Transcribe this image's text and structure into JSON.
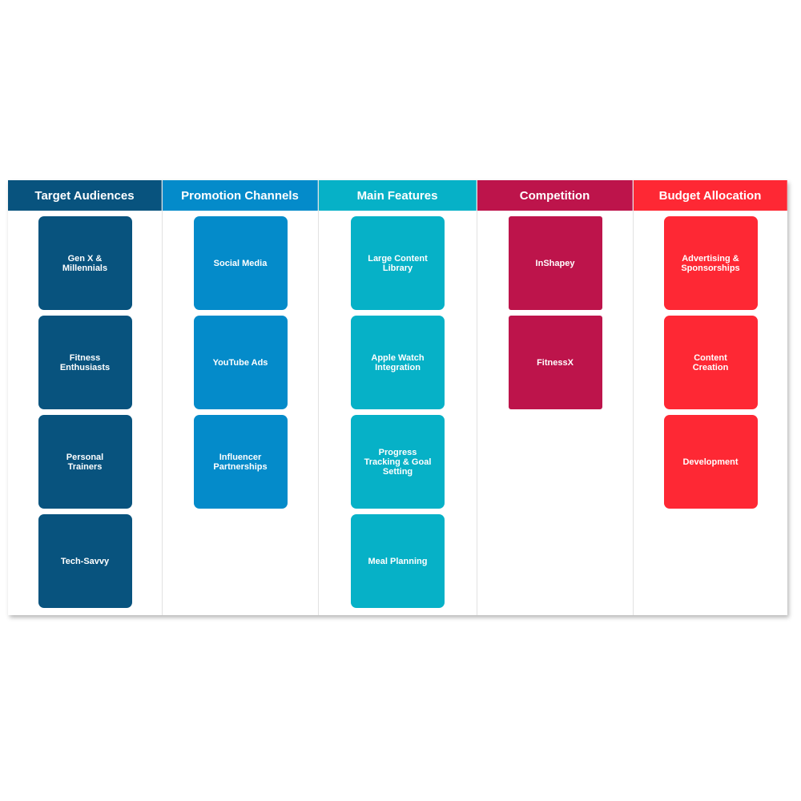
{
  "columns": [
    {
      "title": "Target Audiences",
      "color": "#08537e",
      "radius": "7px",
      "cards": [
        "Gen X &\nMillennials",
        "Fitness\nEnthusiasts",
        "Personal\nTrainers",
        "Tech-Savvy"
      ]
    },
    {
      "title": "Promotion Channels",
      "color": "#048bca",
      "radius": "7px",
      "cards": [
        "Social Media",
        "YouTube Ads",
        "Influencer\nPartnerships"
      ]
    },
    {
      "title": "Main Features",
      "color": "#06b1c7",
      "radius": "7px",
      "cards": [
        "Large Content\nLibrary",
        "Apple Watch\nIntegration",
        "Progress\nTracking & Goal\nSetting",
        "Meal Planning"
      ]
    },
    {
      "title": "Competition",
      "color": "#bd144b",
      "radius": "3px",
      "cards": [
        "InShapey",
        "FitnessX"
      ]
    },
    {
      "title": "Budget Allocation",
      "color": "#fe2834",
      "radius": "7px",
      "cards": [
        "Advertising &\nSponsorships",
        "Content\nCreation",
        "Development"
      ]
    }
  ]
}
